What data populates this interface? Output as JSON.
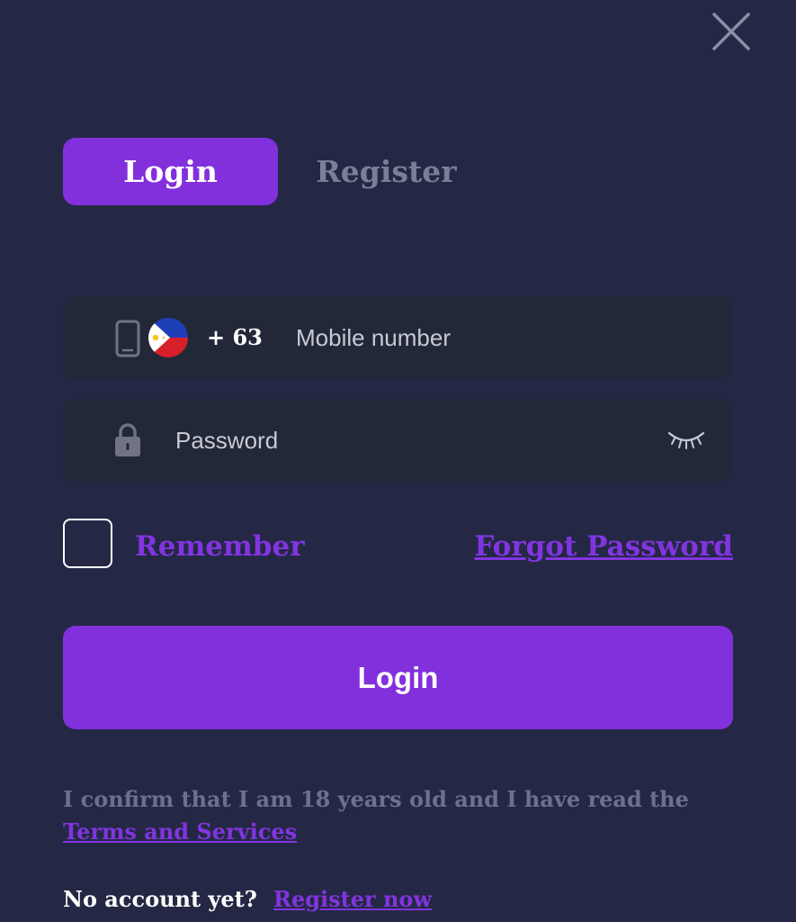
{
  "tabs": {
    "login_label": "Login",
    "register_label": "Register"
  },
  "mobile": {
    "country_code": "+ 63",
    "placeholder": "Mobile number",
    "flag": "philippines-flag"
  },
  "password": {
    "placeholder": "Password"
  },
  "remember_label": "Remember",
  "forgot_password_label": "Forgot Password",
  "login_button_label": "Login",
  "confirm_text": "I confirm that I am 18 years old and I have read the",
  "terms_label": "Terms and Services",
  "no_account_text": "No account yet?",
  "register_now_label": "Register now",
  "icons": {
    "close": "close-icon",
    "phone": "phone-icon",
    "lock": "lock-icon",
    "eye": "eye-closed-icon"
  },
  "colors": {
    "background": "#242845",
    "accent": "#8230dc",
    "field_background": "#222838",
    "muted_text": "#6d7190"
  }
}
